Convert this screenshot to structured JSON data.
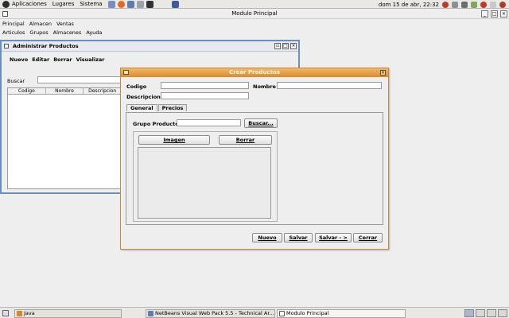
{
  "top_panel": {
    "menus": [
      "Aplicaciones",
      "Lugares",
      "Sistema"
    ],
    "launcher_icons": [
      "text-editor-icon",
      "firefox-icon",
      "evolution-icon",
      "network-icon",
      "terminal-icon"
    ],
    "clock": "dom 15 de abr, 22:32",
    "tray_icons": [
      "update-icon",
      "network-tray-icon",
      "volume-icon",
      "battery-icon",
      "heart-icon",
      "mail-icon",
      "power-icon"
    ]
  },
  "main_window": {
    "title": "Modulo Principal",
    "menu": [
      "Principal",
      "Almacen",
      "Ventas"
    ],
    "toolbar": [
      "Articulos",
      "Grupos",
      "Almacenes",
      "Ayuda"
    ]
  },
  "admin_frame": {
    "title": "Administrar Productos",
    "menu": [
      "Nuevo",
      "Editar",
      "Borrar",
      "Visualizar"
    ],
    "search_label": "Buscar",
    "search_value": "",
    "table_headers": [
      "Codigo",
      "Nombre",
      "Descripcion"
    ]
  },
  "dialog": {
    "title": "Crear Productos",
    "codigo_label": "Codigo",
    "codigo_value": "",
    "nombre_label": "Nombre",
    "nombre_value": "",
    "descripcion_label": "Descripcion",
    "descripcion_value": "",
    "tabs": [
      "General",
      "Precios"
    ],
    "active_tab": "General",
    "grupo_label": "Grupo Producto",
    "grupo_value": "",
    "buscar_button": "Buscar...",
    "imagen_button": "Imagen",
    "borrar_button": "Borrar",
    "buttons": [
      "Nuevo",
      "Salvar",
      "Salvar - >",
      "Cerrar"
    ]
  },
  "bottom_panel": {
    "tasks": [
      "Java",
      "NetBeans Visual Web Pack 5.5 - Technical Ar...",
      "Modulo Principal"
    ]
  },
  "colors": {
    "dialog_title": "#d98b2b",
    "frame_border": "#6b8fbd"
  }
}
